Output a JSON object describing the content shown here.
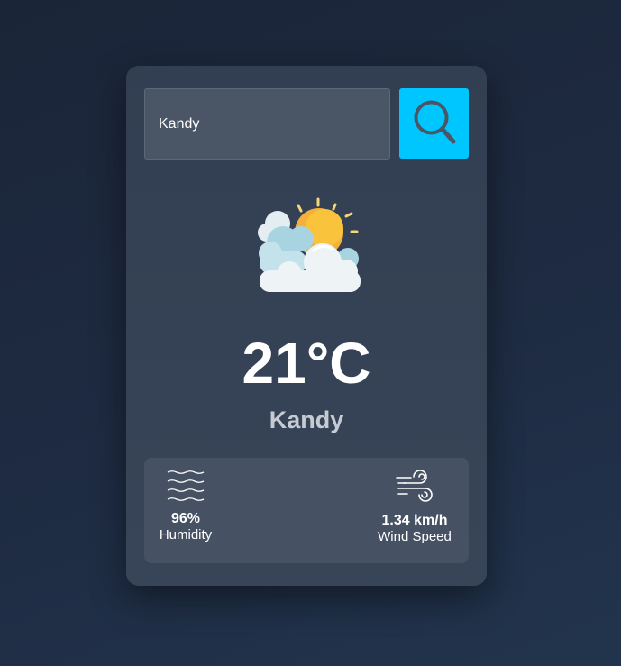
{
  "search": {
    "value": "Kandy",
    "button_icon": "search-icon"
  },
  "weather": {
    "icon": "partly-cloudy-sun-icon",
    "temperature": "21°C",
    "city": "Kandy"
  },
  "details": {
    "humidity": {
      "icon": "humidity-waves-icon",
      "value": "96%",
      "label": "Humidity"
    },
    "wind": {
      "icon": "wind-icon",
      "value": "1.34 km/h",
      "label": "Wind Speed"
    }
  },
  "colors": {
    "accent": "#00c6ff",
    "sun": "#f9c43c",
    "card": "#363f52"
  }
}
